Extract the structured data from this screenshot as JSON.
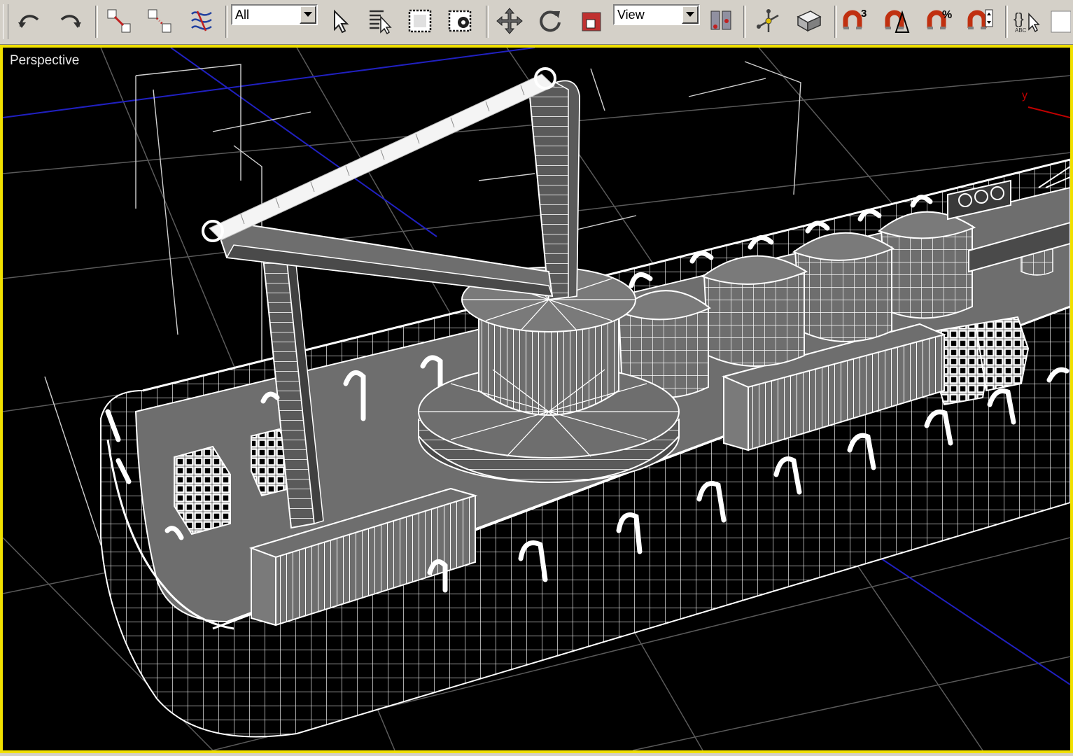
{
  "toolbar": {
    "undo": {
      "icon": "undo-icon"
    },
    "redo": {
      "icon": "redo-icon"
    },
    "select_and_link": {
      "icon": "link-icon"
    },
    "unlink_selection": {
      "icon": "unlink-icon"
    },
    "bind_to_space_warp": {
      "icon": "space-warp-icon"
    },
    "selection_filter": {
      "value": "All"
    },
    "select_object": {
      "icon": "select-cursor-icon"
    },
    "select_by_name": {
      "icon": "select-by-name-icon"
    },
    "region_selection": {
      "icon": "rectangle-selection-icon"
    },
    "window_crossing": {
      "icon": "window-crossing-icon"
    },
    "select_and_move": {
      "icon": "move-icon"
    },
    "select_and_rotate": {
      "icon": "rotate-icon"
    },
    "select_and_scale": {
      "icon": "scale-icon"
    },
    "reference_coordinate_system": {
      "value": "View"
    },
    "pivot_center": {
      "icon": "pivot-center-icon"
    },
    "manipulate": {
      "icon": "manipulate-icon"
    },
    "keyboard_shortcut_override": {
      "icon": "keyboard-override-icon"
    },
    "snaps_toggle": {
      "icon": "snap-3d-icon",
      "text": "3"
    },
    "angle_snap": {
      "icon": "angle-snap-icon"
    },
    "percent_snap": {
      "icon": "percent-snap-icon",
      "text": "%"
    },
    "spinner_snap": {
      "icon": "spinner-snap-icon"
    },
    "edit_named_selection": {
      "icon": "named-selection-icon",
      "text": "ABC"
    }
  },
  "viewport": {
    "label": "Perspective",
    "axis_label": "y",
    "border_color": "#f0e000",
    "background_color": "#000000",
    "wire_color": "#ffffff",
    "solid_color": "#6e6e6e",
    "grid_color": "#5a5a5a",
    "axis_color": "#2020c0"
  }
}
